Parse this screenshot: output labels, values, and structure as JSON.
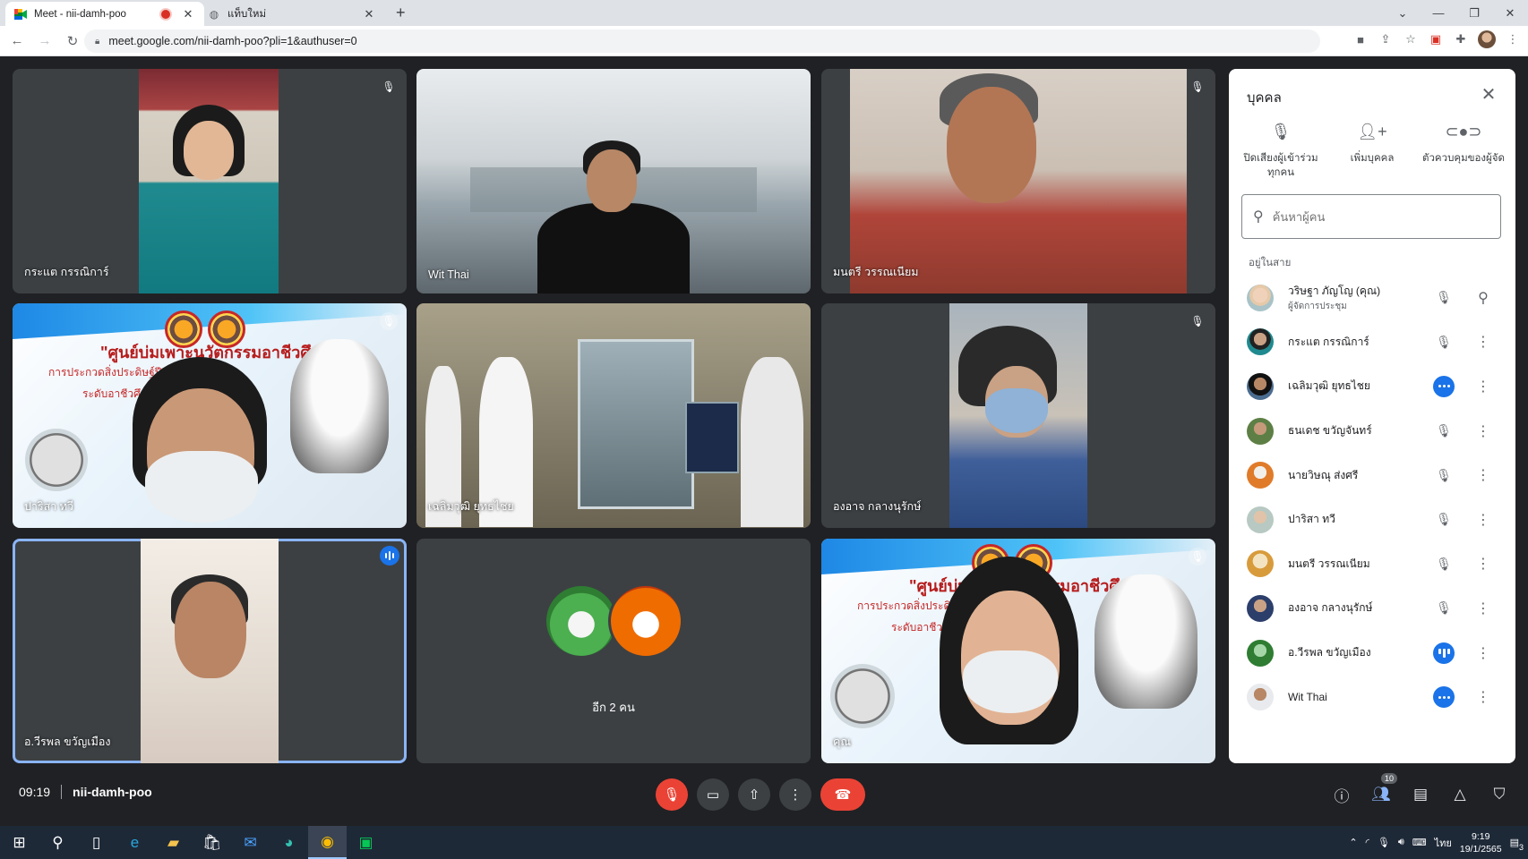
{
  "browser": {
    "tabs": [
      {
        "title": "Meet - nii-damh-poo",
        "active": true
      },
      {
        "title": "แท็บใหม่",
        "active": false
      }
    ],
    "new_tab_label": "+",
    "url": "meet.google.com/nii-damh-poo?pli=1&authuser=0",
    "window_controls": [
      "chevron-down-icon",
      "minimize-icon",
      "restore-icon",
      "close-icon"
    ]
  },
  "tiles": [
    {
      "name": "กระแต กรรณิการ์",
      "muted": true,
      "speaking": false
    },
    {
      "name": "Wit Thai",
      "muted": false,
      "speaking": false
    },
    {
      "name": "มนตรี วรรณเนียม",
      "muted": true,
      "speaking": false
    },
    {
      "name": "ปาริสา ทวี",
      "muted": true,
      "speaking": false
    },
    {
      "name": "เฉลิมวุฒิ ยุทธไชย",
      "muted": false,
      "speaking": false
    },
    {
      "name": "องอาจ กลางนุรักษ์",
      "muted": true,
      "speaking": false
    },
    {
      "name": "อ.วีรพล ขวัญเมือง",
      "muted": false,
      "speaking": true
    },
    {
      "name": "",
      "more_label": "อีก 2 คน"
    },
    {
      "name": "คุณ",
      "muted": true,
      "speaking": false
    }
  ],
  "banner_text": {
    "line1": "\"ศูนย์บ่มเพาะนวัตกรรมอาชีวศึกษา\"",
    "line2": "การประกวดสิ่งประดิษฐ์ปีการศึกษา 2564",
    "line3": "ระดับอาชีวศึกษา (ภาคใต้)"
  },
  "panel": {
    "title": "บุคคล",
    "actions": [
      {
        "icon": "mic-off-icon",
        "label": "ปิดเสียงผู้เข้าร่วมทุกคน"
      },
      {
        "icon": "person-add-icon",
        "label": "เพิ่มบุคคล"
      },
      {
        "icon": "toggle-icon",
        "label": "ตัวควบคุมของผู้จัด"
      }
    ],
    "search_placeholder": "ค้นหาผู้คน",
    "section_label": "อยู่ในสาย",
    "participants": [
      {
        "name": "วริษฐา ภัญโญ (คุณ)",
        "sub": "ผู้จัดการประชุม",
        "status": "muted",
        "action": "pin-icon"
      },
      {
        "name": "กระแต กรรณิการ์",
        "sub": "",
        "status": "muted",
        "action": "more-icon"
      },
      {
        "name": "เฉลิมวุฒิ ยุทธไชย",
        "sub": "",
        "status": "quiet",
        "action": "more-icon"
      },
      {
        "name": "ธนเดช ขวัญจันทร์",
        "sub": "",
        "status": "muted",
        "action": "more-icon"
      },
      {
        "name": "นายวิษณุ ส่งศรี",
        "sub": "",
        "status": "muted",
        "action": "more-icon"
      },
      {
        "name": "ปาริสา ทวี",
        "sub": "",
        "status": "muted",
        "action": "more-icon"
      },
      {
        "name": "มนตรี วรรณเนียม",
        "sub": "",
        "status": "muted",
        "action": "more-icon"
      },
      {
        "name": "องอาจ กลางนุรักษ์",
        "sub": "",
        "status": "muted",
        "action": "more-icon"
      },
      {
        "name": "อ.วีรพล ขวัญเมือง",
        "sub": "",
        "status": "speaking",
        "action": "more-icon"
      },
      {
        "name": "Wit Thai",
        "sub": "",
        "status": "quiet",
        "action": "more-icon"
      }
    ]
  },
  "meeting": {
    "time": "09:19",
    "code": "nii-damh-poo",
    "people_count": "10"
  },
  "taskbar": {
    "lang": "ไทย",
    "time": "9:19",
    "date": "19/1/2565",
    "notifications": "3"
  },
  "colors": {
    "meet_bg": "#202124",
    "tile_bg": "#3c4043",
    "accent_blue": "#1a73e8",
    "end_call_red": "#ea4335",
    "speaking_outline": "#8ab4f8"
  }
}
